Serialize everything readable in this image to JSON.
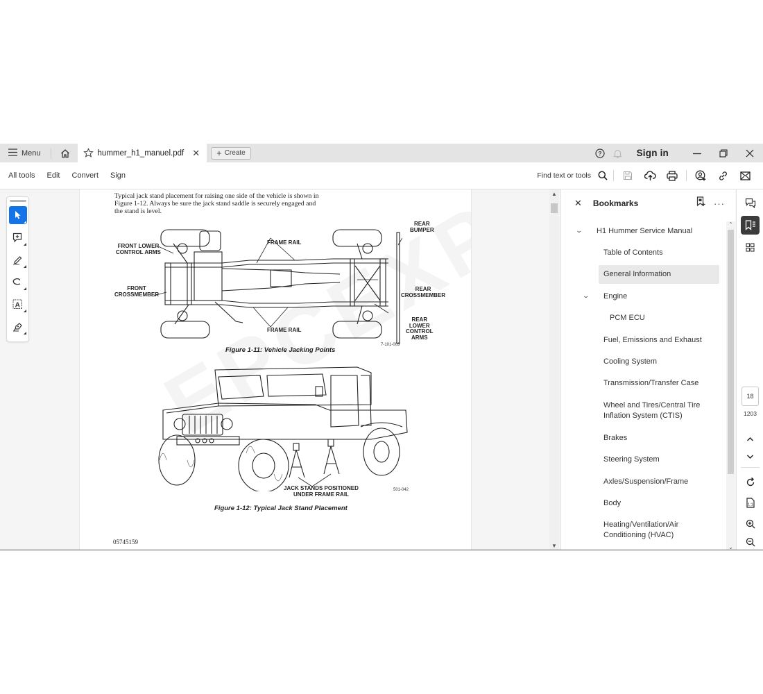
{
  "titlebar": {
    "menu_label": "Menu",
    "tab_filename": "hummer_h1_manuel.pdf",
    "create_label": "Create",
    "signin_label": "Sign in",
    "icons": [
      "menu-icon",
      "home-icon",
      "star-icon",
      "close-icon",
      "plus-icon",
      "help-icon",
      "bell-icon",
      "minimize-icon",
      "restore-icon",
      "close-window-icon"
    ]
  },
  "toolbar": {
    "items": [
      "All tools",
      "Edit",
      "Convert",
      "Sign"
    ],
    "find_label": "Find text or tools",
    "icons": [
      "search-icon",
      "save-icon",
      "cloud-upload-icon",
      "print-icon",
      "share-user-icon",
      "link-icon",
      "email-icon"
    ]
  },
  "tool_rail": {
    "tools": [
      "select-tool",
      "add-comment-tool",
      "highlight-tool",
      "draw-tool",
      "text-select-tool",
      "sign-tool"
    ],
    "active": "select-tool"
  },
  "document": {
    "intro_text": "Typical jack stand placement for raising one side of the vehicle is shown in Figure 1-12. Always be sure the jack stand saddle is securely engaged and the stand is level.",
    "figure1": {
      "caption": "Figure 1-11:   Vehicle Jacking Points",
      "code": "7-101-003",
      "labels": {
        "front_lower_1": "FRONT LOWER",
        "front_lower_2": "CONTROL ARMS",
        "frame_rail_top": "FRAME RAIL",
        "rear_bumper_1": "REAR",
        "rear_bumper_2": "BUMPER",
        "front_cross_1": "FRONT",
        "front_cross_2": "CROSSMEMBER",
        "rear_cross_1": "REAR",
        "rear_cross_2": "CROSSMEMBER",
        "frame_rail_bottom": "FRAME RAIL",
        "rear_lower_1": "REAR",
        "rear_lower_2": "LOWER",
        "rear_lower_3": "CONTROL",
        "rear_lower_4": "ARMS"
      }
    },
    "figure2": {
      "caption": "Figure 1-12:   Typical Jack Stand Placement",
      "code": "501-042",
      "label_1": "JACK STANDS POSITIONED",
      "label_2": "UNDER FRAME RAIL"
    },
    "doc_number": "05745159",
    "watermark": "EPCEXPO.COM"
  },
  "bookmarks": {
    "title": "Bookmarks",
    "items": [
      {
        "label": "H1 Hummer Service Manual",
        "level": 0,
        "expanded": true
      },
      {
        "label": "Table of Contents",
        "level": 1
      },
      {
        "label": "General Information",
        "level": 1,
        "selected": true
      },
      {
        "label": "Engine",
        "level": 1,
        "expanded": true
      },
      {
        "label": "PCM ECU",
        "level": 2
      },
      {
        "label": "Fuel, Emissions and Exhaust",
        "level": 1
      },
      {
        "label": "Cooling System",
        "level": 1
      },
      {
        "label": "Transmission/Transfer Case",
        "level": 1
      },
      {
        "label": "Wheel and Tires/Central Tire Inflation System (CTIS)",
        "level": 1
      },
      {
        "label": "Brakes",
        "level": 1
      },
      {
        "label": "Steering System",
        "level": 1
      },
      {
        "label": "Axles/Suspension/Frame",
        "level": 1
      },
      {
        "label": "Body",
        "level": 1
      },
      {
        "label": "Heating/Ventilation/Air Conditioning (HVAC)",
        "level": 1
      }
    ],
    "two_line": {
      "wheel_1": "Wheel and Tires/Central Tire",
      "wheel_2": "Inflation System (CTIS)",
      "hvac_1": "Heating/Ventilation/Air",
      "hvac_2": "Conditioning (HVAC)"
    }
  },
  "right_rail": {
    "current_page": "18",
    "total_pages": "1203",
    "icons": [
      "comments-icon",
      "bookmarks-icon",
      "thumbnails-icon",
      "page-up-icon",
      "page-down-icon",
      "rotate-icon",
      "fit-page-icon",
      "zoom-in-icon",
      "zoom-out-icon"
    ]
  },
  "colors": {
    "accent": "#1473e6",
    "titlebar_bg": "#e4e4e4",
    "selected_bookmark_bg": "#e9e9e9",
    "active_rail_btn": "#3b3b3b"
  }
}
